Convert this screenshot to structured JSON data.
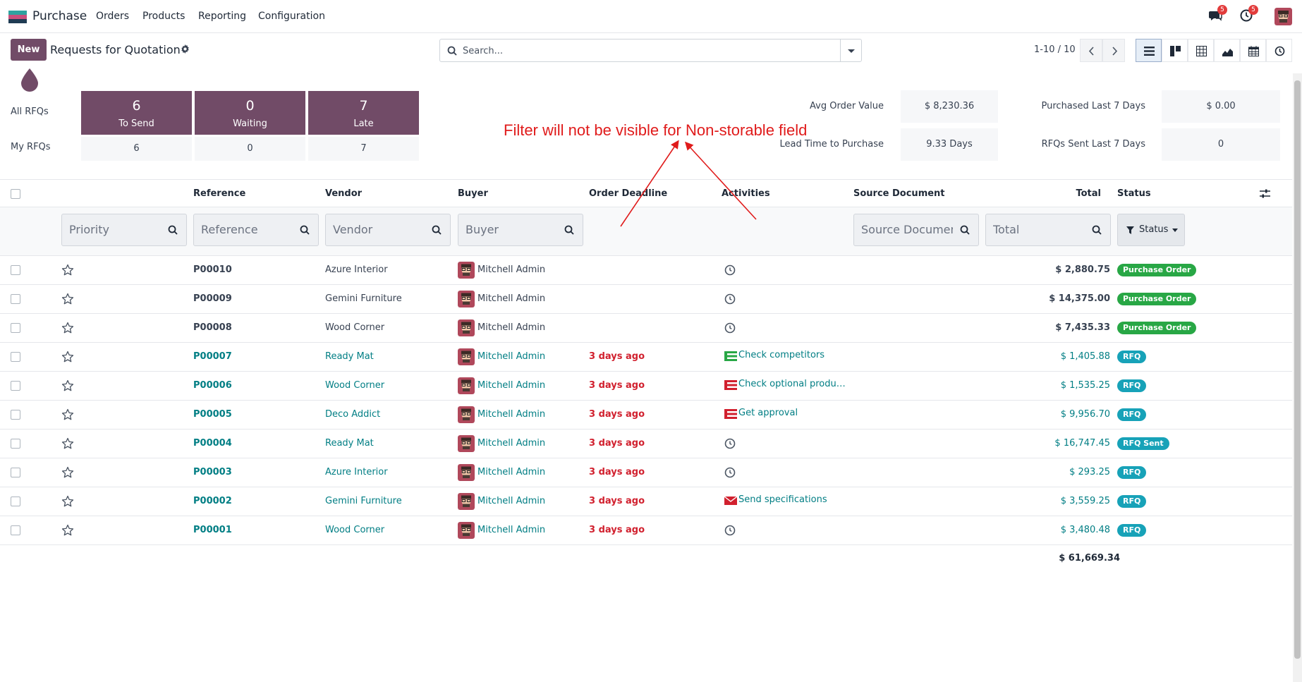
{
  "navbar": {
    "app_name": "Purchase",
    "menu": [
      "Orders",
      "Products",
      "Reporting",
      "Configuration"
    ],
    "chat_badge": "5",
    "activity_badge": "5"
  },
  "control_panel": {
    "new_label": "New",
    "title": "Requests for Quotation",
    "search_placeholder": "Search...",
    "pager": "1-10 / 10"
  },
  "dashboard": {
    "all_rfqs_label": "All RFQs",
    "my_rfqs_label": "My RFQs",
    "cards": [
      {
        "num": "6",
        "label": "To Send",
        "mine": "6"
      },
      {
        "num": "0",
        "label": "Waiting",
        "mine": "0"
      },
      {
        "num": "7",
        "label": "Late",
        "mine": "7"
      }
    ],
    "stats": {
      "avg_order_value_label": "Avg Order Value",
      "avg_order_value": "$ 8,230.36",
      "lead_time_label": "Lead Time to Purchase",
      "lead_time": "9.33 Days",
      "purchased_label": "Purchased Last 7 Days",
      "purchased": "$ 0.00",
      "rfqs_sent_label": "RFQs Sent Last 7 Days",
      "rfqs_sent": "0"
    }
  },
  "annotation": "Filter will not be visible for Non-storable field",
  "table": {
    "columns": {
      "reference": "Reference",
      "vendor": "Vendor",
      "buyer": "Buyer",
      "deadline": "Order Deadline",
      "activities": "Activities",
      "source": "Source Document",
      "total": "Total",
      "status": "Status"
    },
    "filters": {
      "priority": "Priority",
      "reference": "Reference",
      "vendor": "Vendor",
      "buyer": "Buyer",
      "source": "Source Document",
      "total": "Total",
      "status": "Status"
    },
    "rows": [
      {
        "ref": "P00010",
        "vendor": "Azure Interior",
        "buyer": "Mitchell Admin",
        "deadline": "",
        "activity": "",
        "total": "$ 2,880.75",
        "status": "Purchase Order"
      },
      {
        "ref": "P00009",
        "vendor": "Gemini Furniture",
        "buyer": "Mitchell Admin",
        "deadline": "",
        "activity": "",
        "total": "$ 14,375.00",
        "status": "Purchase Order"
      },
      {
        "ref": "P00008",
        "vendor": "Wood Corner",
        "buyer": "Mitchell Admin",
        "deadline": "",
        "activity": "",
        "total": "$ 7,435.33",
        "status": "Purchase Order"
      },
      {
        "ref": "P00007",
        "vendor": "Ready Mat",
        "buyer": "Mitchell Admin",
        "deadline": "3 days ago",
        "activity": "Check competitors",
        "total": "$ 1,405.88",
        "status": "RFQ"
      },
      {
        "ref": "P00006",
        "vendor": "Wood Corner",
        "buyer": "Mitchell Admin",
        "deadline": "3 days ago",
        "activity": "Check optional produ…",
        "total": "$ 1,535.25",
        "status": "RFQ"
      },
      {
        "ref": "P00005",
        "vendor": "Deco Addict",
        "buyer": "Mitchell Admin",
        "deadline": "3 days ago",
        "activity": "Get approval",
        "total": "$ 9,956.70",
        "status": "RFQ"
      },
      {
        "ref": "P00004",
        "vendor": "Ready Mat",
        "buyer": "Mitchell Admin",
        "deadline": "3 days ago",
        "activity": "",
        "total": "$ 16,747.45",
        "status": "RFQ Sent"
      },
      {
        "ref": "P00003",
        "vendor": "Azure Interior",
        "buyer": "Mitchell Admin",
        "deadline": "3 days ago",
        "activity": "",
        "total": "$ 293.25",
        "status": "RFQ"
      },
      {
        "ref": "P00002",
        "vendor": "Gemini Furniture",
        "buyer": "Mitchell Admin",
        "deadline": "3 days ago",
        "activity": "Send specifications",
        "total": "$ 3,559.25",
        "status": "RFQ"
      },
      {
        "ref": "P00001",
        "vendor": "Wood Corner",
        "buyer": "Mitchell Admin",
        "deadline": "3 days ago",
        "activity": "",
        "total": "$ 3,480.48",
        "status": "RFQ"
      }
    ],
    "grand_total": "$ 61,669.34"
  },
  "colors": {
    "brand": "#714b67",
    "teal": "#017e84",
    "late": "#d1202e",
    "po_badge": "#28a745",
    "rfq_badge": "#17a2b8",
    "annotation": "#e01b1b"
  },
  "icons": {
    "view_list": "list-view-icon",
    "view_kanban": "kanban-view-icon",
    "view_pivot": "pivot-view-icon",
    "view_graph": "graph-view-icon",
    "view_calendar": "calendar-view-icon",
    "view_activity": "activity-view-icon"
  }
}
